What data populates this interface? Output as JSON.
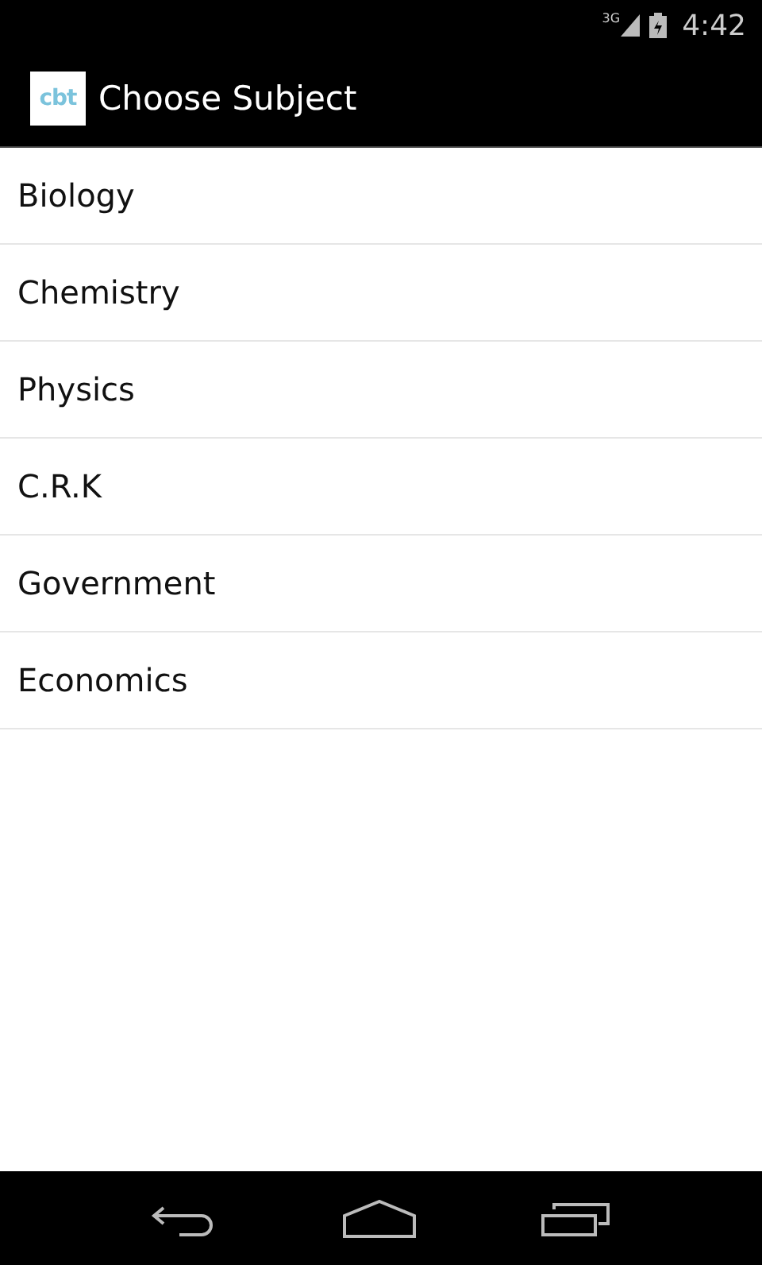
{
  "status_bar": {
    "network": "3G",
    "time": "4:42"
  },
  "action_bar": {
    "logo": "cbt",
    "title": "Choose Subject"
  },
  "subjects": [
    {
      "label": "Biology"
    },
    {
      "label": "Chemistry"
    },
    {
      "label": "Physics"
    },
    {
      "label": "C.R.K"
    },
    {
      "label": "Government"
    },
    {
      "label": "Economics"
    }
  ]
}
